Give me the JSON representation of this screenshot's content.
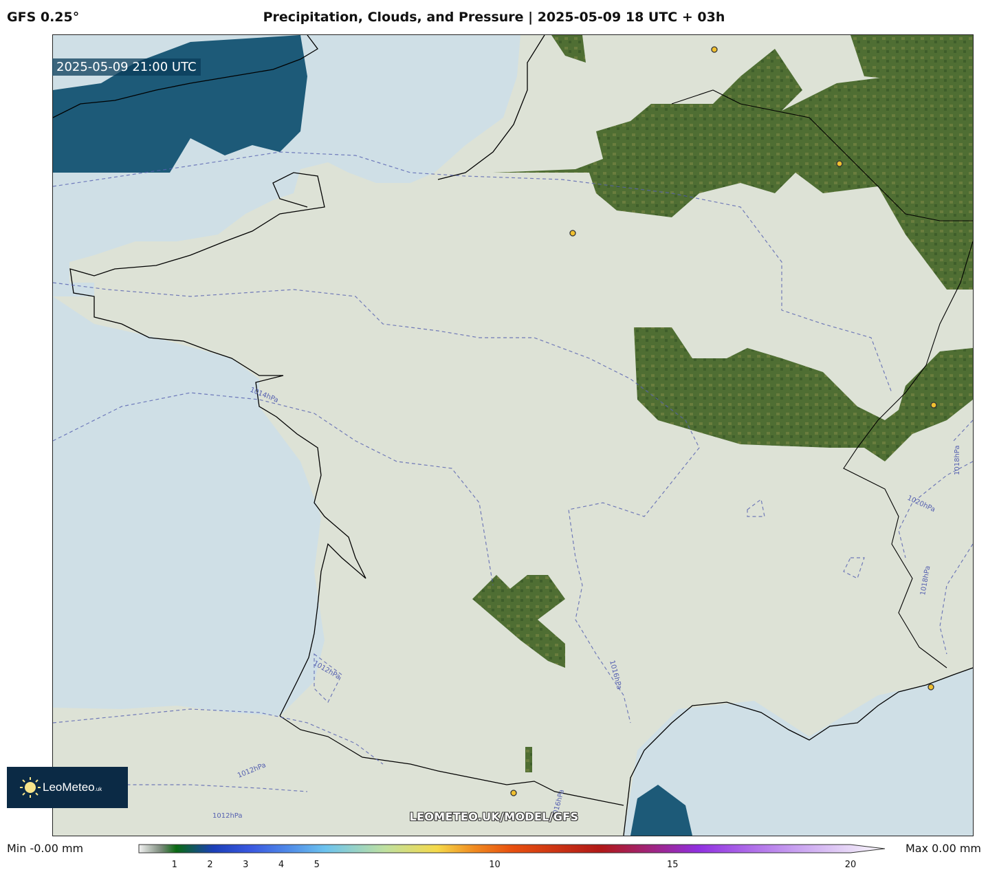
{
  "header": {
    "model": "GFS 0.25°",
    "title": "Precipitation, Clouds, and Pressure | 2025-05-09 18 UTC + 03h"
  },
  "map": {
    "valid_time": "2025-05-09 21:00 UTC",
    "isobar_labels": [
      "1014hPa",
      "1012hPa",
      "1016hPa",
      "1020hPa",
      "1018hPa",
      "1012hPa",
      "1012hPa",
      "1016hPa",
      "1018hPa"
    ],
    "colors": {
      "sea": "#cfdfe6",
      "land_cloud": "#dde2d6",
      "clear_land": "#4f6e33",
      "clear_sea": "#1d5a78",
      "coastline": "#000000",
      "isobar": "#5560b0",
      "city_marker": "#f0c030"
    }
  },
  "branding": {
    "logo_text": "LeoMeteo",
    "logo_suffix": ".uk",
    "watermark": "LEOMETEO.UK/MODEL/GFS"
  },
  "legend": {
    "min_label": "Min -0.00 mm",
    "max_label": "Max 0.00 mm",
    "ticks": [
      "1",
      "2",
      "3",
      "4",
      "5",
      "10",
      "15",
      "20"
    ],
    "tick_values": [
      1,
      2,
      3,
      4,
      5,
      10,
      15,
      20
    ],
    "range": [
      0,
      20
    ]
  }
}
